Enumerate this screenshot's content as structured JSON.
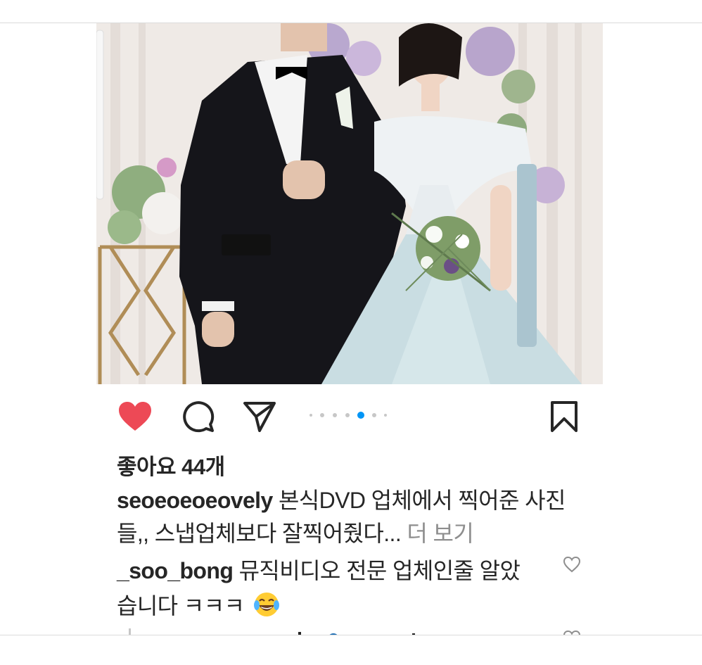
{
  "post": {
    "image_alt": "wedding photo of groom in black tuxedo and bride in light blue gown with bouquet",
    "carousel": {
      "count": 7,
      "active_index": 4
    },
    "likes_label": "좋아요 44개",
    "caption": {
      "username": "seoeoeoeovely",
      "text": " 본식DVD 업체에서 찍어준 사진들,, 스냅업체보다 잘찍어줬다...",
      "more_label": " 더 보기"
    },
    "comments": [
      {
        "username": "_soo_bong",
        "text": " 뮤직비디오 전문 업체인줄 알았습니다 ㅋㅋㅋ",
        "emoji": "face-with-tears-of-joy"
      }
    ]
  },
  "icons": {
    "like": "heart-icon",
    "comment": "comment-bubble-icon",
    "share": "paper-plane-icon",
    "save": "bookmark-icon"
  },
  "colors": {
    "like_red": "#ed4956",
    "carousel_active": "#0095f6",
    "text": "#262626",
    "muted": "#8e8e8e"
  }
}
